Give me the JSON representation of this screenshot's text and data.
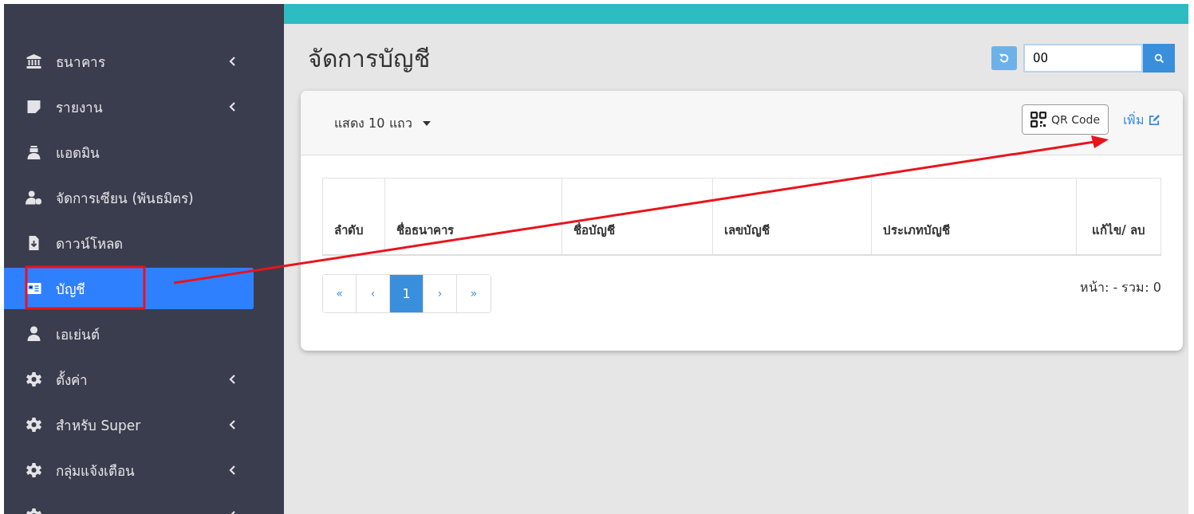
{
  "sidebar": {
    "items": [
      {
        "label": "ธนาคาร",
        "has_submenu": true,
        "selected": false
      },
      {
        "label": "รายงาน",
        "has_submenu": true,
        "selected": false
      },
      {
        "label": "แอดมิน",
        "has_submenu": false,
        "selected": false
      },
      {
        "label": "จัดการเซียน (พันธมิตร)",
        "has_submenu": false,
        "selected": false
      },
      {
        "label": "ดาวน์โหลด",
        "has_submenu": false,
        "selected": false
      },
      {
        "label": "บัญชี",
        "has_submenu": false,
        "selected": true
      },
      {
        "label": "เอเย่นต์",
        "has_submenu": false,
        "selected": false
      },
      {
        "label": "ตั้งค่า",
        "has_submenu": true,
        "selected": false
      },
      {
        "label": "สำหรับ Super",
        "has_submenu": true,
        "selected": false
      },
      {
        "label": "กลุ่มแจ้งเตือน",
        "has_submenu": true,
        "selected": false
      },
      {
        "has_submenu": true,
        "selected": false
      }
    ]
  },
  "page": {
    "title": "จัดการบัญชี"
  },
  "search": {
    "value": "00"
  },
  "toolbar": {
    "page_size": "แสดง 10 แถว",
    "qr_button": "QR Code",
    "add_link": "เพิ่ม"
  },
  "table": {
    "columns": [
      "ลำดับ",
      "ชื่อธนาคาร",
      "ชื่อบัญชี",
      "เลขบัญชี",
      "ประเภทบัญชี",
      "แก้ไข/ ลบ"
    ]
  },
  "pagination": {
    "pages": [
      {
        "label": "«",
        "selected": false
      },
      {
        "label": "‹",
        "selected": false
      },
      {
        "label": "1",
        "selected": true
      },
      {
        "label": "›",
        "selected": false
      },
      {
        "label": "»",
        "selected": false
      }
    ],
    "summary": "หน้า: - รวม: 0"
  }
}
